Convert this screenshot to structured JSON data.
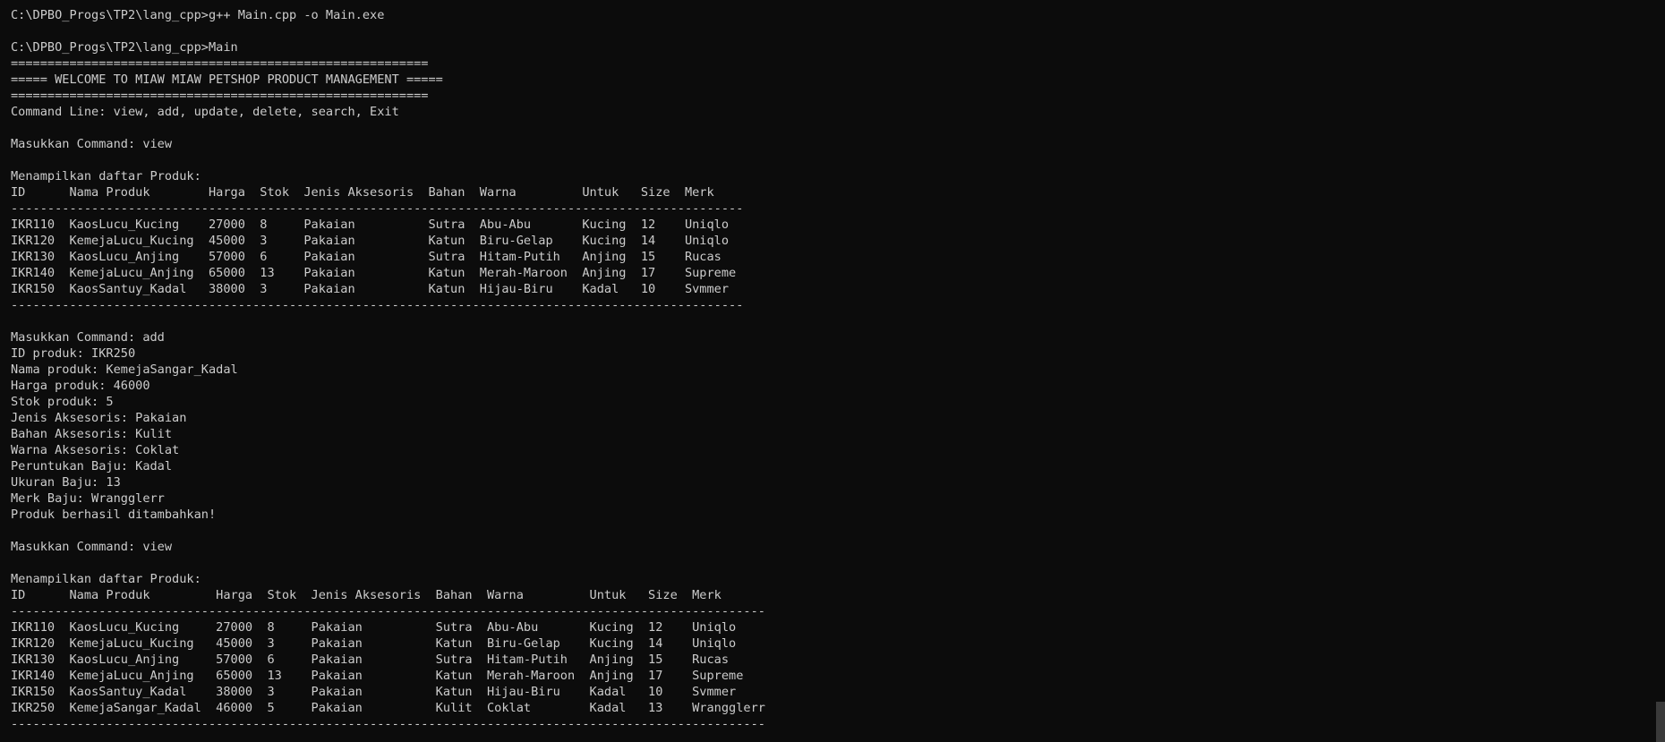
{
  "colors": {
    "background": "#0c0c0c",
    "foreground": "#cccccc",
    "scrollbar_thumb": "#3a3a3a"
  },
  "terminal": {
    "lines": [
      "C:\\DPBO_Progs\\TP2\\lang_cpp>g++ Main.cpp -o Main.exe",
      "",
      "C:\\DPBO_Progs\\TP2\\lang_cpp>Main",
      "=========================================================",
      "===== WELCOME TO MIAW MIAW PETSHOP PRODUCT MANAGEMENT =====",
      "=========================================================",
      "Command Line: view, add, update, delete, search, Exit",
      "",
      "Masukkan Command: view",
      "",
      "Menampilkan daftar Produk:",
      "ID      Nama Produk        Harga  Stok  Jenis Aksesoris  Bahan  Warna         Untuk   Size  Merk",
      "----------------------------------------------------------------------------------------------------",
      "IKR110  KaosLucu_Kucing    27000  8     Pakaian          Sutra  Abu-Abu       Kucing  12    Uniqlo",
      "IKR120  KemejaLucu_Kucing  45000  3     Pakaian          Katun  Biru-Gelap    Kucing  14    Uniqlo",
      "IKR130  KaosLucu_Anjing    57000  6     Pakaian          Sutra  Hitam-Putih   Anjing  15    Rucas",
      "IKR140  KemejaLucu_Anjing  65000  13    Pakaian          Katun  Merah-Maroon  Anjing  17    Supreme",
      "IKR150  KaosSantuy_Kadal   38000  3     Pakaian          Katun  Hijau-Biru    Kadal   10    Svmmer",
      "----------------------------------------------------------------------------------------------------",
      "",
      "Masukkan Command: add",
      "ID produk: IKR250",
      "Nama produk: KemejaSangar_Kadal",
      "Harga produk: 46000",
      "Stok produk: 5",
      "Jenis Aksesoris: Pakaian",
      "Bahan Aksesoris: Kulit",
      "Warna Aksesoris: Coklat",
      "Peruntukan Baju: Kadal",
      "Ukuran Baju: 13",
      "Merk Baju: Wrangglerr",
      "Produk berhasil ditambahkan!",
      "",
      "Masukkan Command: view",
      "",
      "Menampilkan daftar Produk:",
      "ID      Nama Produk         Harga  Stok  Jenis Aksesoris  Bahan  Warna         Untuk   Size  Merk",
      "-------------------------------------------------------------------------------------------------------",
      "IKR110  KaosLucu_Kucing     27000  8     Pakaian          Sutra  Abu-Abu       Kucing  12    Uniqlo",
      "IKR120  KemejaLucu_Kucing   45000  3     Pakaian          Katun  Biru-Gelap    Kucing  14    Uniqlo",
      "IKR130  KaosLucu_Anjing     57000  6     Pakaian          Sutra  Hitam-Putih   Anjing  15    Rucas",
      "IKR140  KemejaLucu_Anjing   65000  13    Pakaian          Katun  Merah-Maroon  Anjing  17    Supreme",
      "IKR150  KaosSantuy_Kadal    38000  3     Pakaian          Katun  Hijau-Biru    Kadal   10    Svmmer",
      "IKR250  KemejaSangar_Kadal  46000  5     Pakaian          Kulit  Coklat        Kadal   13    Wrangglerr",
      "-------------------------------------------------------------------------------------------------------"
    ]
  }
}
